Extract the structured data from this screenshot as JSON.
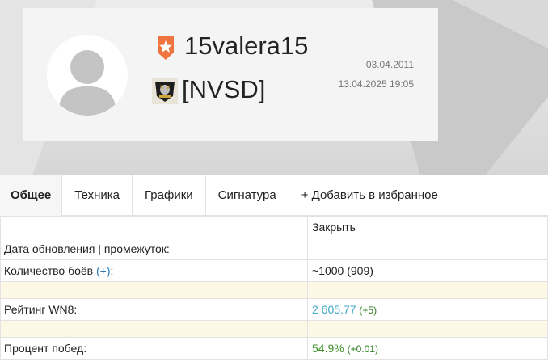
{
  "profile": {
    "username": "15valera15",
    "clan_tag": "[NVSD]",
    "registered_date": "03.04.2011",
    "last_battle_datetime": "13.04.2025 19:05",
    "icons": {
      "avatar": "user-avatar-icon",
      "badge": "orange-star-badge-icon",
      "clan": "clan-emblem-icon"
    }
  },
  "tabs": [
    {
      "label": "Общее",
      "active": true
    },
    {
      "label": "Техника",
      "active": false
    },
    {
      "label": "Графики",
      "active": false
    },
    {
      "label": "Сигнатура",
      "active": false
    },
    {
      "label": "+ Добавить в избранное",
      "active": false
    }
  ],
  "stats": {
    "close_link": "Закрыть",
    "update_label": "Дата обновления | промежуток:",
    "battles": {
      "label": "Количество боёв",
      "plus": "(+)",
      "colon": ":",
      "value": "~1000 (909)"
    },
    "wn8": {
      "label": "Рейтинг WN8:",
      "value": "2 605.77",
      "delta": "(+5)"
    },
    "winrate": {
      "label": "Процент побед:",
      "value": "54.9%",
      "delta": "(+0.01)"
    }
  },
  "colors": {
    "link_blue": "#2a7ab8",
    "wn8_teal": "#3ea8c8",
    "win_green": "#3f8f2a",
    "badge_orange": "#f0743e",
    "highlight_row": "#fdf8e6"
  }
}
